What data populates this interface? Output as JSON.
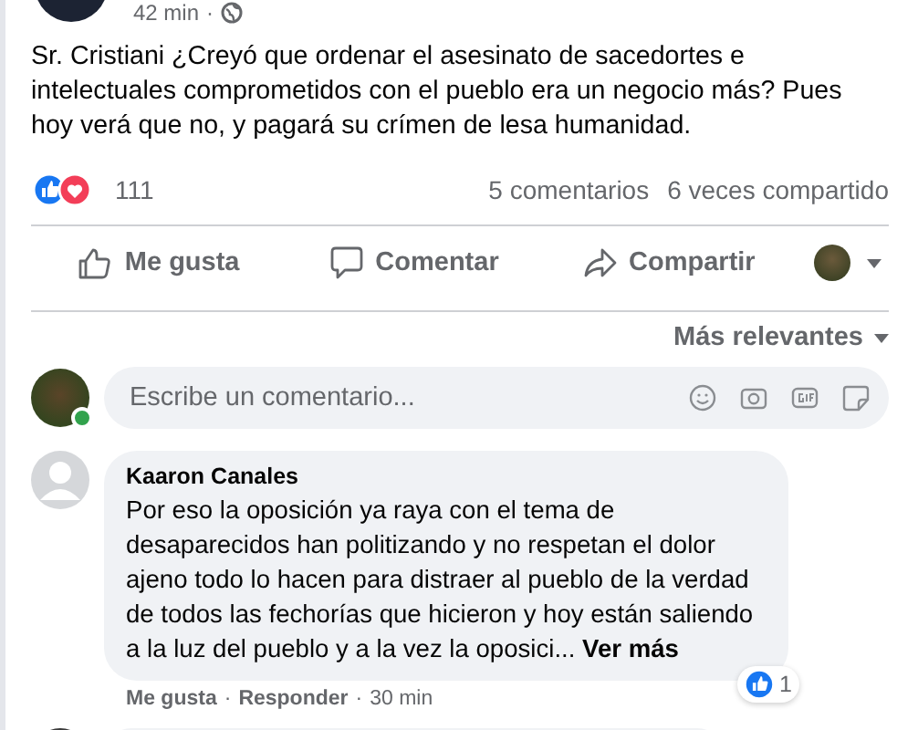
{
  "post": {
    "time": "42 min",
    "time_separator": "·",
    "text": "Sr. Cristiani ¿Creyó que ordenar el asesinato de sacedortes e intelectuales comprometidos con el pueblo era un negocio más? Pues hoy verá que no, y pagará su crímen de lesa humanidad.",
    "reaction_count": "111",
    "comments_count": "5 comentarios",
    "shares_count": "6 veces compartido"
  },
  "actions": [
    {
      "kind": "like",
      "label": "Me gusta"
    },
    {
      "kind": "comment",
      "label": "Comentar"
    },
    {
      "kind": "share",
      "label": "Compartir"
    }
  ],
  "sort": {
    "label": "Más relevantes"
  },
  "composer": {
    "placeholder": "Escribe un comentario...",
    "online": true
  },
  "comments": [
    {
      "author": "Kaaron Canales",
      "text": "Por eso la oposición ya raya con el tema de desaparecidos han politizando y no respetan el dolor ajeno todo lo hacen para distraer al pueblo de la verdad de todos las fechorías que hicieron y hoy están saliendo a la luz del pueblo y a la vez la oposici...",
      "more": "Ver más",
      "like": "Me gusta",
      "separator_1": "·",
      "reply": "Responder",
      "separator_2": "·",
      "time": "30 min",
      "reactions": "1"
    }
  ]
}
